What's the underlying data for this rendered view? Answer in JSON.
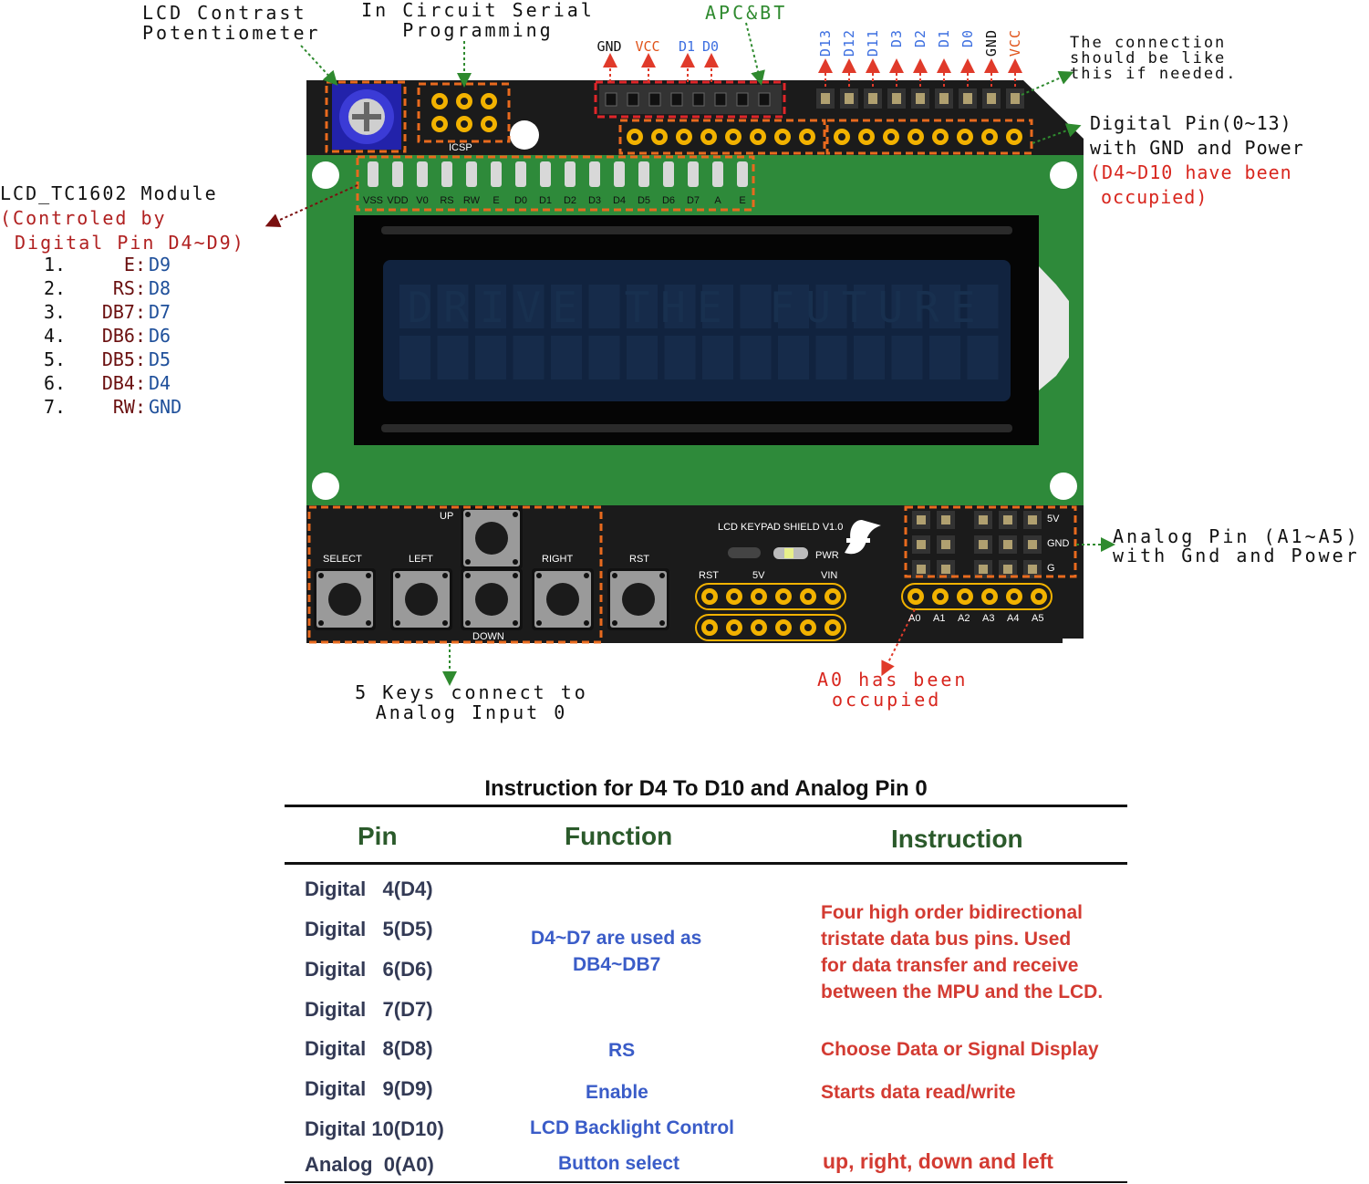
{
  "annotations": {
    "lcd_contrast": [
      "LCD  Contrast",
      "Potentiometer"
    ],
    "icsp": [
      "In Circuit Serial",
      "Programming"
    ],
    "apc_bt": "APC&BT",
    "connection_note": [
      "The connection",
      "should be like",
      "this if needed."
    ],
    "digital_pin": [
      "Digital Pin(0~13)",
      "with GND and Power"
    ],
    "digital_occupied": [
      "(D4~D10 have been",
      "occupied)"
    ],
    "lcd_module": "LCD_TC1602 Module",
    "lcd_module_sub": [
      "(Controled by",
      "Digital Pin D4~D9)"
    ],
    "lcd_map": [
      {
        "num": "1.",
        "name": "E",
        "pin": "D9"
      },
      {
        "num": "2.",
        "name": "RS",
        "pin": "D8"
      },
      {
        "num": "3.",
        "name": "DB7",
        "pin": "D7"
      },
      {
        "num": "4.",
        "name": "DB6",
        "pin": "D6"
      },
      {
        "num": "5.",
        "name": "DB5",
        "pin": "D5"
      },
      {
        "num": "6.",
        "name": "DB4",
        "pin": "D4"
      },
      {
        "num": "7.",
        "name": "RW",
        "pin": "GND"
      }
    ],
    "keys": [
      "5 Keys connect to",
      "Analog Input 0"
    ],
    "a0_occupied": [
      "A0 has been",
      "occupied"
    ],
    "analog_pin": [
      "Analog Pin (A1~A5)",
      "with Gnd and Power"
    ]
  },
  "header_pins": {
    "apc_left": [
      {
        "label": "GND",
        "color": "#111111"
      },
      {
        "label": "VCC",
        "color": "#e0531a"
      },
      {
        "label": "D1",
        "color": "#3d6fe0"
      },
      {
        "label": "D0",
        "color": "#3d6fe0"
      }
    ],
    "right_vertical": [
      {
        "label": "D13",
        "color": "#3d6fe0"
      },
      {
        "label": "D12",
        "color": "#3d6fe0"
      },
      {
        "label": "D11",
        "color": "#3d6fe0"
      },
      {
        "label": "D3",
        "color": "#3d6fe0"
      },
      {
        "label": "D2",
        "color": "#3d6fe0"
      },
      {
        "label": "D1",
        "color": "#3d6fe0"
      },
      {
        "label": "D0",
        "color": "#3d6fe0"
      },
      {
        "label": "GND",
        "color": "#111111"
      },
      {
        "label": "VCC",
        "color": "#e0531a"
      }
    ]
  },
  "board": {
    "icsp_label": "ICSP",
    "lcd_pins": [
      "VSS",
      "VDD",
      "V0",
      "RS",
      "RW",
      "E",
      "D0",
      "D1",
      "D2",
      "D3",
      "D4",
      "D5",
      "D6",
      "D7",
      "A",
      "E"
    ],
    "lcd_text": "DRIVE THE FUTURE",
    "buttons": {
      "up": "UP",
      "select": "SELECT",
      "left": "LEFT",
      "right": "RIGHT",
      "down": "DOWN",
      "rst": "RST"
    },
    "shield_name": "LCD KEYPAD SHIELD V1.0",
    "pwr": "PWR",
    "power_header": [
      "RST",
      "5V",
      "VIN"
    ],
    "analog_side": [
      "5V",
      "GND",
      "G"
    ],
    "analog_labels": [
      "A0",
      "A1",
      "A2",
      "A3",
      "A4",
      "A5"
    ]
  },
  "table": {
    "title": "Instruction for D4 To D10 and Analog Pin 0",
    "headers": {
      "pin": "Pin",
      "function": "Function",
      "instruction": "Instruction"
    },
    "pins": [
      "Digital   4(D4)",
      "Digital   5(D5)",
      "Digital   6(D6)",
      "Digital   7(D7)",
      "Digital   8(D8)",
      "Digital   9(D9)",
      "Digital 10(D10)",
      "Analog  0(A0)"
    ],
    "functions": {
      "d4_d7": [
        "D4~D7 are used as",
        "DB4~DB7"
      ],
      "d8": "RS",
      "d9": "Enable",
      "d10": "LCD Backlight Control",
      "a0": "Button select"
    },
    "instructions": {
      "d4_d7": [
        "Four high order bidirectional",
        "tristate data bus pins. Used",
        "for data transfer and receive",
        "between the MPU and the LCD."
      ],
      "d8": "Choose Data or Signal Display",
      "d9": "Starts data read/write",
      "a0": "up, right, down and left"
    }
  },
  "colors": {
    "board_black": "#1b1b1b",
    "pcb_green": "#2e8a3a",
    "lcd_blue": "#11233f",
    "highlight_orange": "#e86a1e",
    "pad_gold": "#f2b200"
  }
}
